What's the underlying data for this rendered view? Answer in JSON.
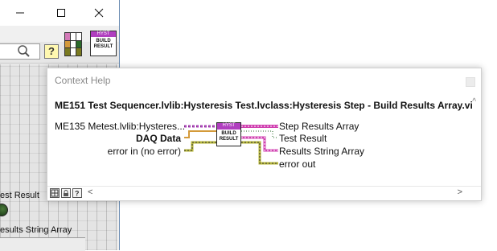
{
  "main_window": {
    "controls": {
      "minimize": "—",
      "maximize": "☐",
      "close": "✕"
    },
    "toolbar": {
      "help_label": "?"
    },
    "vi_icon": {
      "header": "HYST",
      "body_line1": "BUILD",
      "body_line2": "RESULT"
    },
    "front_panel": {
      "led_label": "est Result",
      "array_label": "esults String Array"
    }
  },
  "context_help": {
    "title": "Context Help",
    "vi_path": "ME151 Test Sequencer.lvlib:Hysteresis Test.lvclass:Hysteresis Step - Build Results Array.vi",
    "connector_icon": {
      "header": "HYST",
      "body_line1": "BUILD",
      "body_line2": "RESULT"
    },
    "inputs": [
      {
        "label": "ME135 Metest.lvlib:Hysteres...",
        "bold": false
      },
      {
        "label": "DAQ Data",
        "bold": true
      },
      {
        "label": "error in (no error)",
        "bold": false
      }
    ],
    "outputs": [
      {
        "label": "Step Results Array",
        "bold": false
      },
      {
        "label": "Test Result",
        "bold": false
      },
      {
        "label": "Results String Array",
        "bold": false
      },
      {
        "label": "error out",
        "bold": false
      }
    ],
    "footer": {
      "scroll_left": "<",
      "scroll_right": ">"
    },
    "colors": {
      "class_wire": "#b03fbf",
      "daq_wire": "#d49a3a",
      "error_wire": "#7a7a20",
      "bool_wire": "#2a6a2a",
      "string_wire": "#d040b0"
    }
  }
}
